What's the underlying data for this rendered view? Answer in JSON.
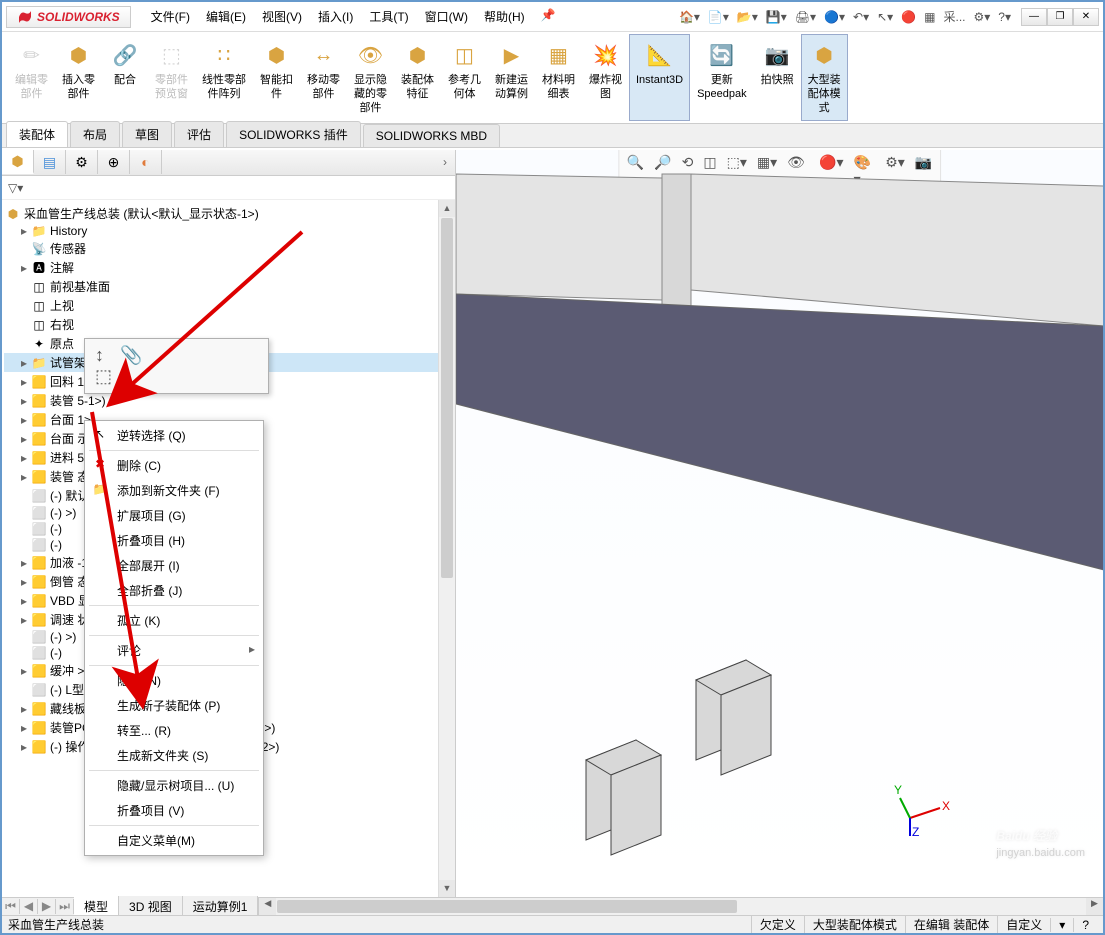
{
  "app": {
    "logo": "SOLIDWORKS"
  },
  "menu": {
    "items": [
      "文件(F)",
      "编辑(E)",
      "视图(V)",
      "插入(I)",
      "工具(T)",
      "窗口(W)",
      "帮助(H)"
    ],
    "pin": "📌",
    "right_ext": "采..."
  },
  "ribbon": {
    "items": [
      {
        "label": "编辑零\n部件",
        "disabled": true
      },
      {
        "label": "插入零\n部件"
      },
      {
        "label": "配合"
      },
      {
        "label": "零部件\n预览窗",
        "disabled": true
      },
      {
        "label": "线性零部\n件阵列"
      },
      {
        "label": "智能扣\n件"
      },
      {
        "label": "移动零\n部件"
      },
      {
        "label": "显示隐\n藏的零\n部件"
      },
      {
        "label": "装配体\n特征"
      },
      {
        "label": "参考几\n何体"
      },
      {
        "label": "新建运\n动算例"
      },
      {
        "label": "材料明\n细表"
      },
      {
        "label": "爆炸视\n图"
      },
      {
        "label": "Instant3D",
        "active": true
      },
      {
        "label": "更新\nSpeedpak"
      },
      {
        "label": "拍快照"
      },
      {
        "label": "大型装\n配体模\n式",
        "active": true
      }
    ]
  },
  "tabs": {
    "items": [
      {
        "label": "装配体",
        "active": true
      },
      {
        "label": "布局"
      },
      {
        "label": "草图"
      },
      {
        "label": "评估"
      },
      {
        "label": "SOLIDWORKS 插件"
      },
      {
        "label": "SOLIDWORKS MBD"
      }
    ]
  },
  "tree": {
    "root": "采血管生产线总装 (默认<默认_显示状态-1>)",
    "items": [
      {
        "i": 1,
        "ex": "▸",
        "ic": "📁",
        "t": "History"
      },
      {
        "i": 1,
        "ex": "",
        "ic": "📡",
        "t": "传感器"
      },
      {
        "i": 1,
        "ex": "▸",
        "ic": "🅰",
        "t": "注解"
      },
      {
        "i": 1,
        "ex": "",
        "ic": "◫",
        "t": "前视基准面"
      },
      {
        "i": 1,
        "ex": "",
        "ic": "◫",
        "t": "上视"
      },
      {
        "i": 1,
        "ex": "",
        "ic": "◫",
        "t": "右视"
      },
      {
        "i": 1,
        "ex": "",
        "ic": "✦",
        "t": "原点"
      },
      {
        "i": 1,
        "ex": "▸",
        "ic": "📁",
        "t": "试管架",
        "sel": true
      },
      {
        "i": 1,
        "ex": "▸",
        "ic": "🟨",
        "t": "回料                               1>)"
      },
      {
        "i": 1,
        "ex": "▸",
        "ic": "🟨",
        "t": "装管                               5-1>)"
      },
      {
        "i": 1,
        "ex": "▸",
        "ic": "🟨",
        "t": "台面                               1>)"
      },
      {
        "i": 1,
        "ex": "▸",
        "ic": "🟨",
        "t": "台面                               示状态 1>)"
      },
      {
        "i": 1,
        "ex": "▸",
        "ic": "🟨",
        "t": "进料                               5-1>)"
      },
      {
        "i": 1,
        "ex": "▸",
        "ic": "🟨",
        "t": "装管                               态-1>)"
      },
      {
        "i": 1,
        "ex": "",
        "ic": "⬜",
        "t": "(-)                                 默认)"
      },
      {
        "i": 1,
        "ex": "",
        "ic": "⬜",
        "t": "(-)                                 >)"
      },
      {
        "i": 1,
        "ex": "",
        "ic": "⬜",
        "t": "(-)"
      },
      {
        "i": 1,
        "ex": "",
        "ic": "⬜",
        "t": "(-)"
      },
      {
        "i": 1,
        "ex": "▸",
        "ic": "🟨",
        "t": "加液                               -1>)"
      },
      {
        "i": 1,
        "ex": "▸",
        "ic": "🟨",
        "t": "倒管                               态-1>)"
      },
      {
        "i": 1,
        "ex": "▸",
        "ic": "🟨",
        "t": "VBD                                显示状态-1>)"
      },
      {
        "i": 1,
        "ex": "▸",
        "ic": "🟨",
        "t": "调速                               状态 1>)"
      },
      {
        "i": 1,
        "ex": "",
        "ic": "⬜",
        "t": "(-)                                 >)"
      },
      {
        "i": 1,
        "ex": "",
        "ic": "⬜",
        "t": "(-)"
      },
      {
        "i": 1,
        "ex": "▸",
        "ic": "🟨",
        "t": "缓冲                               >)"
      },
      {
        "i": 1,
        "ex": "",
        "ic": "⬜",
        "t": "(-) L型托片成品400新款马达ITO<    默认)"
      },
      {
        "i": 1,
        "ex": "▸",
        "ic": "🟨",
        "t": "藏线板<1> (默认<<默认>_显示状态 1>)"
      },
      {
        "i": 1,
        "ex": "▸",
        "ic": "🟨",
        "t": "装管PC板<1> (默认<<默认>_显示状态 1>)"
      },
      {
        "i": 1,
        "ex": "▸",
        "ic": "🟨",
        "t": "(-) 操作组件2<1> (第2种形式<显示状态-2>)"
      }
    ]
  },
  "mini_toolbar": {
    "icons": [
      "↕",
      "📎",
      "⬚"
    ]
  },
  "context_menu": {
    "items": [
      {
        "icon": "↖",
        "label": "逆转选择 (Q)"
      },
      {
        "sep": true
      },
      {
        "icon": "✖",
        "label": "删除 (C)",
        "red": true
      },
      {
        "icon": "📁",
        "label": "添加到新文件夹 (F)"
      },
      {
        "label": "扩展项目 (G)"
      },
      {
        "label": "折叠项目 (H)"
      },
      {
        "label": "全部展开 (I)"
      },
      {
        "label": "全部折叠 (J)"
      },
      {
        "sep": true
      },
      {
        "label": "孤立 (K)"
      },
      {
        "sep": true
      },
      {
        "label": "评论",
        "arrow": true
      },
      {
        "sep": true
      },
      {
        "label": "隐藏 (N)"
      },
      {
        "label": "生成新子装配体 (P)"
      },
      {
        "label": "转至... (R)"
      },
      {
        "label": "生成新文件夹 (S)"
      },
      {
        "sep": true
      },
      {
        "label": "隐藏/显示树项目... (U)"
      },
      {
        "label": "折叠项目 (V)"
      },
      {
        "sep": true
      },
      {
        "label": "自定义菜单(M)"
      }
    ]
  },
  "bottom_tabs": {
    "items": [
      "模型",
      "3D 视图",
      "运动算例1"
    ]
  },
  "triad": {
    "x": "X",
    "y": "Y",
    "z": "Z"
  },
  "status": {
    "left": "采血管生产线总装",
    "segs": [
      "欠定义",
      "大型装配体模式",
      "在编辑 装配体",
      "自定义"
    ]
  },
  "watermark": {
    "main": "Baidu 经验",
    "sub": "jingyan.baidu.com"
  }
}
